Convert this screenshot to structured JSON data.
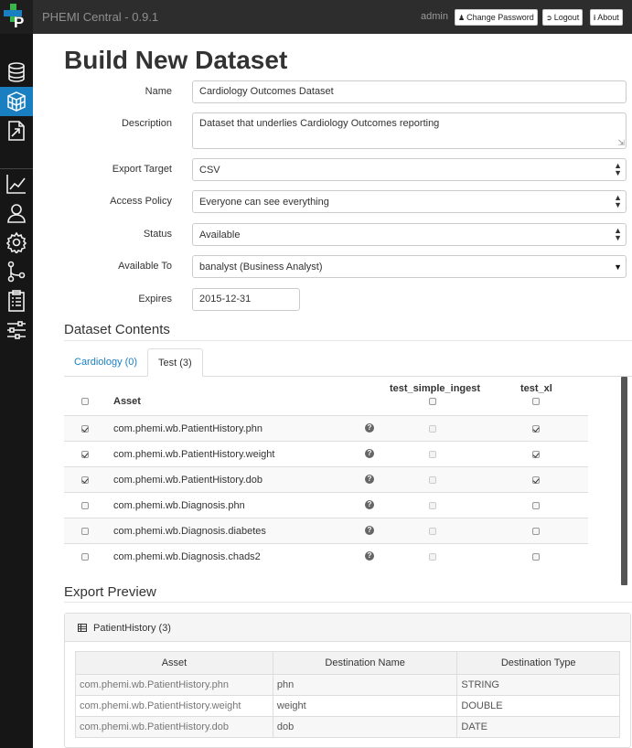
{
  "header": {
    "app_title": "PHEMI Central - 0.9.1",
    "user": "admin",
    "change_password_label": "Change Password",
    "logout_label": "Logout",
    "about_label": "About"
  },
  "sidebar": {
    "items": [
      {
        "name": "database"
      },
      {
        "name": "datasets",
        "active": true
      },
      {
        "name": "export"
      },
      {
        "name": "analytics"
      },
      {
        "name": "users"
      },
      {
        "name": "settings"
      },
      {
        "name": "workflow"
      },
      {
        "name": "reports"
      },
      {
        "name": "controls"
      }
    ],
    "active_color": "#1a7fc1"
  },
  "page": {
    "title": "Build New Dataset"
  },
  "form": {
    "name_label": "Name",
    "name_value": "Cardiology Outcomes Dataset",
    "description_label": "Description",
    "description_value": "Dataset that underlies Cardiology Outcomes reporting",
    "export_target_label": "Export Target",
    "export_target_value": "CSV",
    "access_policy_label": "Access Policy",
    "access_policy_value": "Everyone can see everything",
    "status_label": "Status",
    "status_value": "Available",
    "available_to_label": "Available To",
    "available_to_value": "banalyst (Business Analyst)",
    "expires_label": "Expires",
    "expires_value": "2015-12-31"
  },
  "contents": {
    "title": "Dataset Contents",
    "tabs": [
      {
        "label": "Cardiology (0)",
        "active": false
      },
      {
        "label": "Test (3)",
        "active": true
      }
    ],
    "columns": {
      "asset": "Asset",
      "col1": "test_simple_ingest",
      "col2": "test_xl"
    },
    "rows": [
      {
        "asset": "com.phemi.wb.PatientHistory.phn",
        "selected": true,
        "test_simple_ingest": false,
        "test_xl": true
      },
      {
        "asset": "com.phemi.wb.PatientHistory.weight",
        "selected": true,
        "test_simple_ingest": false,
        "test_xl": true
      },
      {
        "asset": "com.phemi.wb.PatientHistory.dob",
        "selected": true,
        "test_simple_ingest": false,
        "test_xl": true
      },
      {
        "asset": "com.phemi.wb.Diagnosis.phn",
        "selected": false,
        "test_simple_ingest": false,
        "test_xl": false
      },
      {
        "asset": "com.phemi.wb.Diagnosis.diabetes",
        "selected": false,
        "test_simple_ingest": false,
        "test_xl": false
      },
      {
        "asset": "com.phemi.wb.Diagnosis.chads2",
        "selected": false,
        "test_simple_ingest": false,
        "test_xl": false
      }
    ],
    "help_glyph": "?"
  },
  "preview": {
    "title": "Export Preview",
    "panel_title": "PatientHistory (3)",
    "headers": [
      "Asset",
      "Destination Name",
      "Destination Type"
    ],
    "rows": [
      [
        "com.phemi.wb.PatientHistory.phn",
        "phn",
        "STRING"
      ],
      [
        "com.phemi.wb.PatientHistory.weight",
        "weight",
        "DOUBLE"
      ],
      [
        "com.phemi.wb.PatientHistory.dob",
        "dob",
        "DATE"
      ]
    ]
  }
}
